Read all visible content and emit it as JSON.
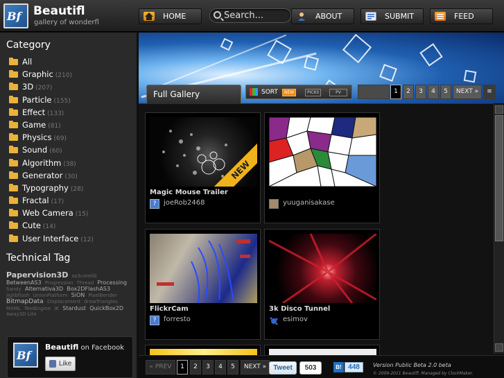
{
  "header": {
    "logo_text": "Bf",
    "title": "Beautifl",
    "subtitle": "gallery of wonderfl",
    "nav": {
      "home": "HOME",
      "about": "ABOUT",
      "submit": "SUBMIT",
      "feed": "FEED"
    },
    "search_placeholder": "Search..."
  },
  "sidebar": {
    "category_heading": "Category",
    "categories": [
      {
        "label": "All",
        "count": ""
      },
      {
        "label": "Graphic",
        "count": "(210)"
      },
      {
        "label": "3D",
        "count": "(207)"
      },
      {
        "label": "Particle",
        "count": "(155)"
      },
      {
        "label": "Effect",
        "count": "(133)"
      },
      {
        "label": "Game",
        "count": "(81)"
      },
      {
        "label": "Physics",
        "count": "(69)"
      },
      {
        "label": "Sound",
        "count": "(60)"
      },
      {
        "label": "Algorithm",
        "count": "(38)"
      },
      {
        "label": "Generator",
        "count": "(30)"
      },
      {
        "label": "Typography",
        "count": "(28)"
      },
      {
        "label": "Fractal",
        "count": "(17)"
      },
      {
        "label": "Web Camera",
        "count": "(15)"
      },
      {
        "label": "Cute",
        "count": "(14)"
      },
      {
        "label": "User Interface",
        "count": "(12)"
      }
    ],
    "tag_heading": "Technical Tag",
    "tags": [
      {
        "label": "Papervision3D",
        "size": "t1"
      },
      {
        "label": "as3corelib",
        "size": "t0"
      },
      {
        "label": "BetweenAS3",
        "size": "t2"
      },
      {
        "label": "Progression",
        "size": "t0"
      },
      {
        "label": "Thread",
        "size": "t0"
      },
      {
        "label": "Processing",
        "size": "t2"
      },
      {
        "label": "Sandy",
        "size": "t0"
      },
      {
        "label": "Alternativa3D",
        "size": "t2"
      },
      {
        "label": "Box2DFlashAS3",
        "size": "t2"
      },
      {
        "label": "jiglibflash",
        "size": "t0"
      },
      {
        "label": "UnionPlatform",
        "size": "t0"
      },
      {
        "label": "SiON",
        "size": "t2"
      },
      {
        "label": "PixelBender",
        "size": "t0"
      },
      {
        "label": "BitmapData",
        "size": "t3"
      },
      {
        "label": "Displacement",
        "size": "t0"
      },
      {
        "label": "drawTriangles",
        "size": "t0"
      },
      {
        "label": "MXML",
        "size": "t0"
      },
      {
        "label": "TextEngine",
        "size": "t0"
      },
      {
        "label": "IK",
        "size": "t0"
      },
      {
        "label": "Stardust",
        "size": "t2"
      },
      {
        "label": "QuickBox2D",
        "size": "t2"
      },
      {
        "label": "Away3D Lite",
        "size": "t0"
      }
    ],
    "facebook": {
      "logo_text": "Bf",
      "name": "Beautifl",
      "on_text": "on Facebook",
      "like_label": "Like"
    }
  },
  "gallery": {
    "tab_label": "Full Gallery",
    "sort": {
      "label": "SORT",
      "options": [
        "NEW",
        "PICKS",
        "PV"
      ],
      "active": "NEW"
    },
    "pagination_top": {
      "pages": [
        "1",
        "2",
        "3",
        "4",
        "5"
      ],
      "current": "1",
      "next_label": "NEXT »"
    },
    "items": [
      {
        "title": "Magic Mouse Trailer",
        "user": "joeRob2468",
        "badge": "NEW"
      },
      {
        "title": "",
        "user": "yuuganisakase",
        "badge": ""
      },
      {
        "title": "FlickrCam",
        "user": "forresto",
        "badge": ""
      },
      {
        "title": "3k Disco Tunnel",
        "user": "esimov",
        "badge": ""
      }
    ],
    "pagination_bottom": {
      "prev_label": "« PREV",
      "pages": [
        "1",
        "2",
        "3",
        "4",
        "5"
      ],
      "current": "1",
      "next_label": "NEXT »"
    }
  },
  "footer": {
    "tweet_label": "Tweet",
    "tweet_count": "503",
    "hatena_label": "B!",
    "hatena_count": "448",
    "version": "Version Public Beta 2.0 beta",
    "copyright": "© 2009-2011 Beautifl. Managed by ClockMaker."
  },
  "colors": {
    "accent_orange": "#f28a14",
    "facebook_blue": "#5872a7",
    "hatena_blue": "#1f6fc4"
  }
}
